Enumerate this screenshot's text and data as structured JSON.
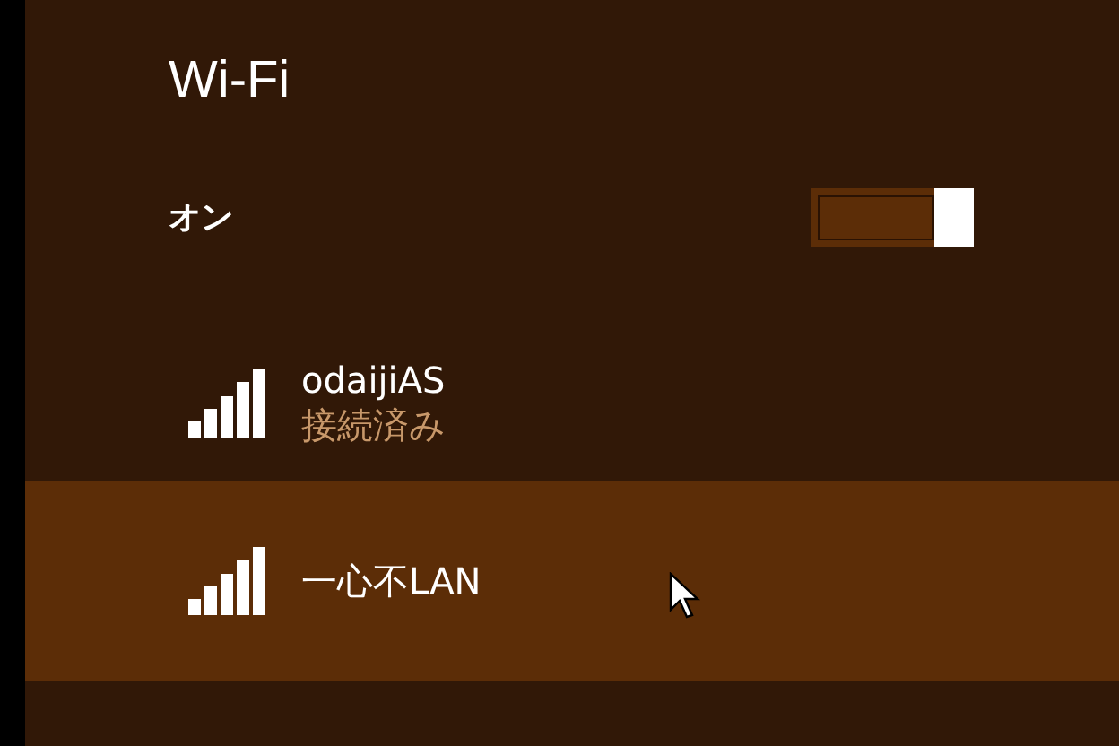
{
  "title": "Wi-Fi",
  "wifi": {
    "label": "オン",
    "on": true
  },
  "networks": [
    {
      "name": "odaijiAS",
      "status": "接続済み",
      "selected": false
    },
    {
      "name": "一心不LAN",
      "selected": true
    }
  ]
}
